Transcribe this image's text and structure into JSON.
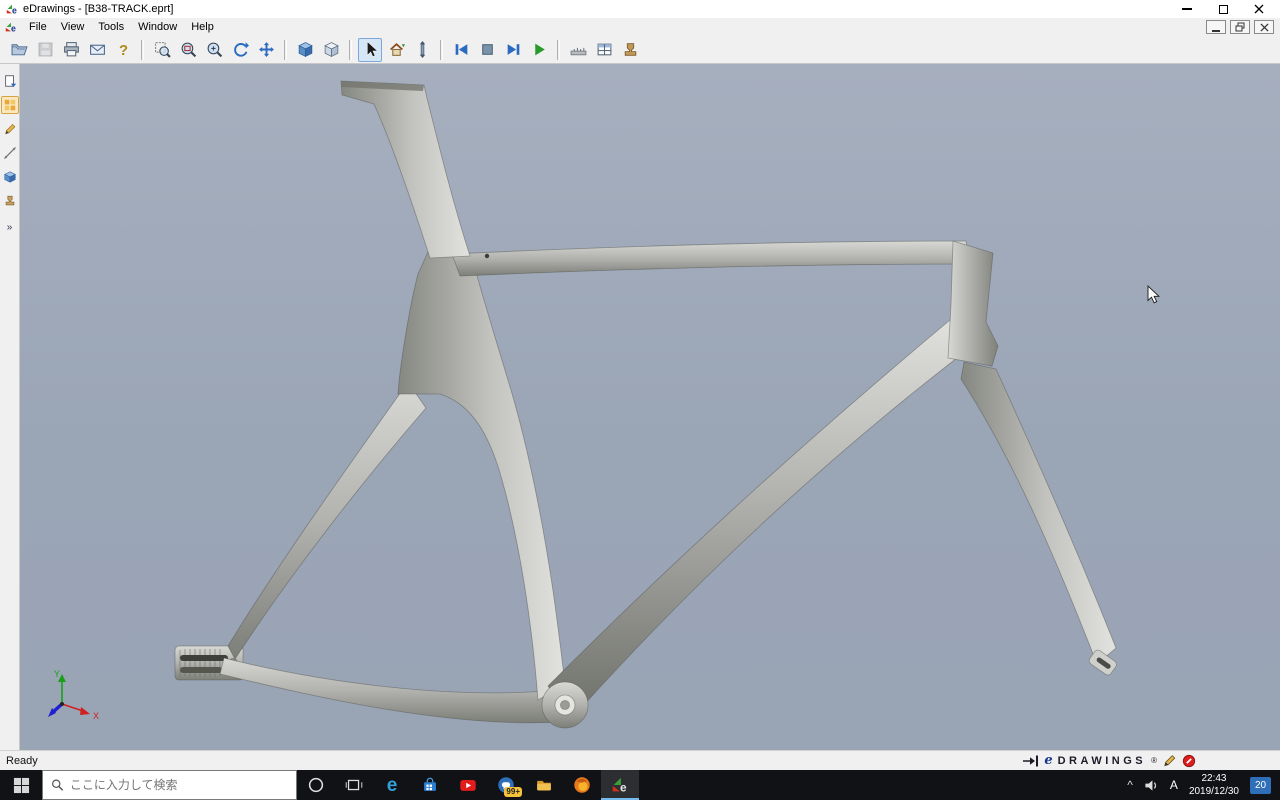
{
  "window": {
    "title": "eDrawings - [B38-TRACK.eprt]",
    "app_name": "eDrawings",
    "document_name": "B38-TRACK.eprt"
  },
  "menubar": {
    "items": [
      "File",
      "View",
      "Tools",
      "Window",
      "Help"
    ]
  },
  "toolbar": {
    "icons": [
      "open",
      "save",
      "print",
      "send",
      "help",
      "zoom-to-fit",
      "zoom-area",
      "zoom",
      "rotate-view",
      "pan",
      "shaded-view",
      "hidden-lines-view",
      "select",
      "home-view",
      "3d-drawing-view",
      "animation-previous",
      "animation-stop",
      "animation-next",
      "animation-play",
      "measure",
      "mass-properties",
      "stamp"
    ]
  },
  "side_toolbar": {
    "icons": [
      "sheets",
      "components",
      "markup",
      "dimensions",
      "model-tree",
      "stamps"
    ],
    "expand_glyph": "»"
  },
  "viewport": {
    "axis_labels": {
      "x": "X",
      "y": "Y"
    }
  },
  "statusbar": {
    "status": "Ready",
    "brand_mark": "e",
    "brand_text": "DRAWINGS",
    "registered_mark": "®"
  },
  "taskbar": {
    "search_placeholder": "ここに入力して検索",
    "badge_count": "99+",
    "tray": {
      "ime_mode": "A",
      "time": "22:43",
      "date": "2019/12/30",
      "notification_count": "20"
    }
  }
}
